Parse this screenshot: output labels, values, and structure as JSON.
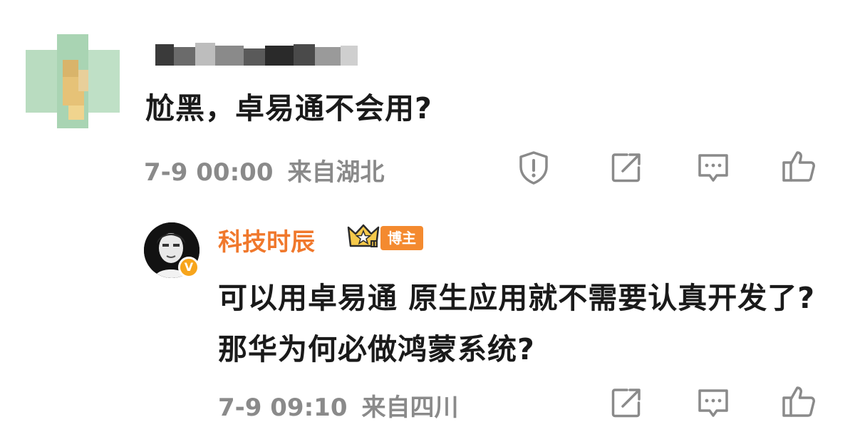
{
  "comment": {
    "text": "尬黑，卓易通不会用?",
    "time": "7-9 00:00",
    "location": "来自湖北"
  },
  "reply": {
    "author": "科技时辰",
    "badge": "博主",
    "text": "可以用卓易通 原生应用就不需要认真开发了? 那华为何必做鸿蒙系统?",
    "time": "7-9 09:10",
    "location": "来自四川"
  },
  "icons": {
    "report": "shield-alert-icon",
    "share": "share-icon",
    "comment": "comment-icon",
    "like": "thumbs-up-icon"
  },
  "colors": {
    "author_name": "#f0782c",
    "badge": "#f48a2f",
    "meta_text": "#8a8a8a",
    "icon": "#8a8a8a"
  }
}
